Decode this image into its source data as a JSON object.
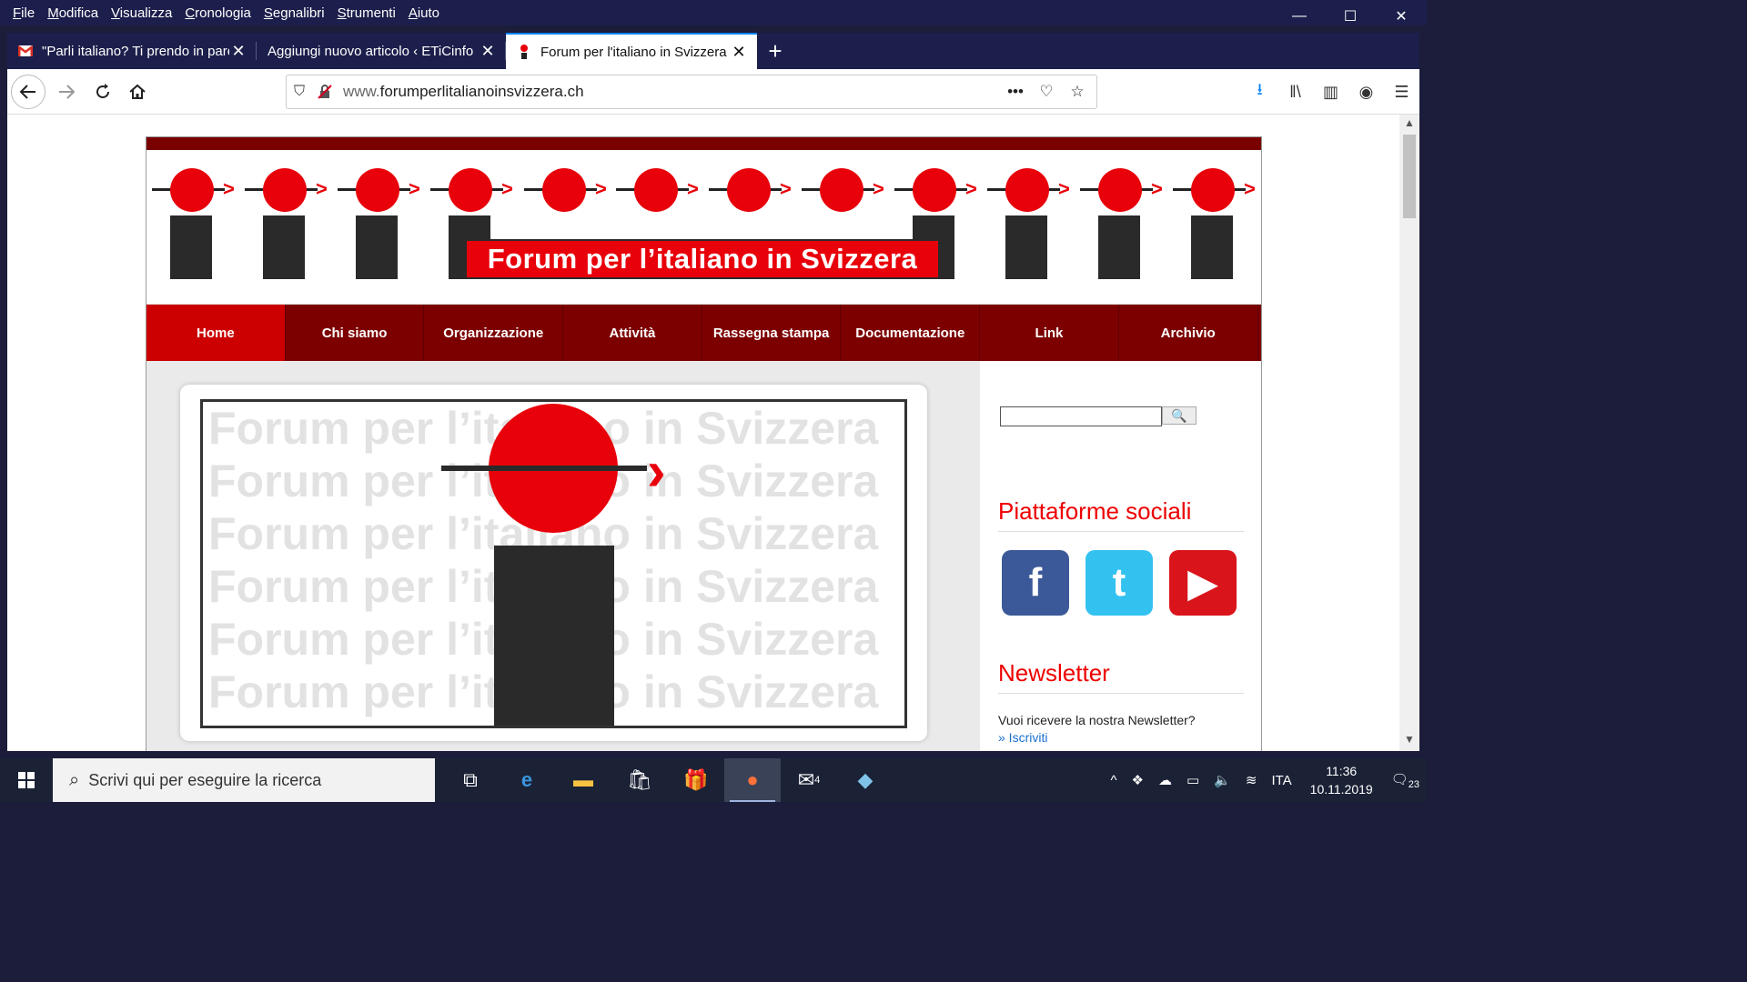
{
  "menubar": {
    "items": [
      {
        "underline": "F",
        "rest": "ile"
      },
      {
        "underline": "M",
        "rest": "odifica"
      },
      {
        "underline": "V",
        "rest": "isualizza"
      },
      {
        "underline": "C",
        "rest": "ronologia"
      },
      {
        "underline": "S",
        "rest": "egnalibri"
      },
      {
        "underline": "S",
        "rest": "trumenti"
      },
      {
        "underline": "A",
        "rest": "iuto"
      }
    ]
  },
  "window_controls": {
    "minimize": "—",
    "maximize": "☐",
    "close": "✕"
  },
  "tabs": [
    {
      "title": "\"Parli italiano? Ti prendo in pare",
      "icon": "gmail-icon"
    },
    {
      "title": "Aggiungi nuovo articolo ‹ ETiCinfo",
      "icon": "none"
    },
    {
      "title": "Forum per l'italiano in Svizzera",
      "icon": "forum-icon",
      "active": true
    }
  ],
  "newtab": "+",
  "url": {
    "prefix": "www.",
    "domain": "forumperlitalianoinsvizzera.ch"
  },
  "site": {
    "banner": "Forum per l’italiano in Svizzera",
    "nav": [
      "Home",
      "Chi siamo",
      "Organizzazione",
      "Attività",
      "Rassegna stampa",
      "Documentazione",
      "Link",
      "Archivio"
    ],
    "watermark": "Forum per l’italiano in Svizzera",
    "sidebar": {
      "social_title": "Piattaforme sociali",
      "newsletter_title": "Newsletter",
      "newsletter_text": "Vuoi ricevere la nostra Newsletter?",
      "newsletter_link": "» Iscriviti",
      "search_button": "🔍"
    },
    "colors": {
      "accent": "#e8000a",
      "nav_bg": "#7d0000",
      "nav_active": "#cc0000"
    }
  },
  "taskbar": {
    "search_placeholder": "Scrivi qui per eseguire la ricerca",
    "mail_badge": "4",
    "language": "ITA",
    "time": "11:36",
    "date": "10.11.2019",
    "notif_count": "23"
  }
}
